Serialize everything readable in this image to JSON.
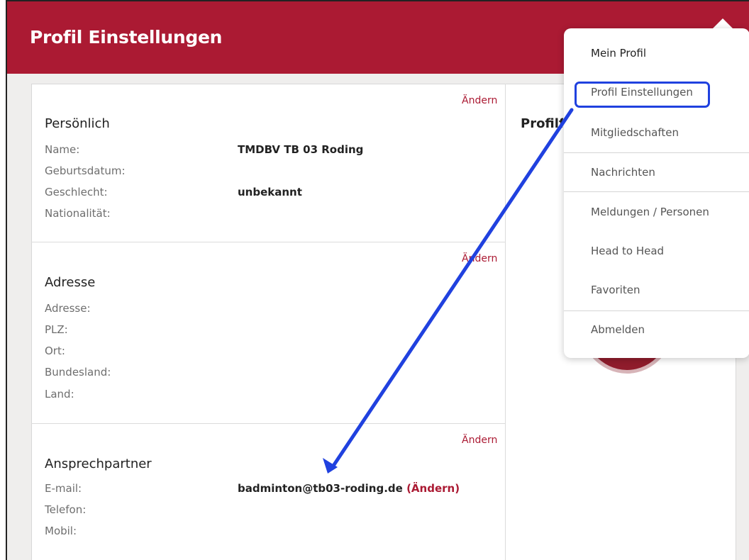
{
  "header": {
    "title": "Profil Einstellungen"
  },
  "sections": {
    "personal": {
      "title": "Persönlich",
      "change_label": "Ändern",
      "fields": [
        {
          "label": "Name:",
          "value": "TMDBV TB 03 Roding"
        },
        {
          "label": "Geburtsdatum:",
          "value": ""
        },
        {
          "label": "Geschlecht:",
          "value": "unbekannt"
        },
        {
          "label": "Nationalität:",
          "value": ""
        }
      ]
    },
    "address": {
      "title": "Adresse",
      "change_label": "Ändern",
      "fields": [
        {
          "label": "Adresse:",
          "value": ""
        },
        {
          "label": "PLZ:",
          "value": ""
        },
        {
          "label": "Ort:",
          "value": ""
        },
        {
          "label": "Bundesland:",
          "value": ""
        },
        {
          "label": "Land:",
          "value": ""
        }
      ]
    },
    "contact": {
      "title": "Ansprechpartner",
      "change_label": "Ändern",
      "fields": [
        {
          "label": "E-mail:",
          "value": "badminton@tb03-roding.de",
          "inline_change": "(Ändern)"
        },
        {
          "label": "Telefon:",
          "value": ""
        },
        {
          "label": "Mobil:",
          "value": ""
        }
      ]
    }
  },
  "right_panel": {
    "title_partial": "Profilfoto"
  },
  "menu": {
    "items": [
      {
        "label": "Mein Profil"
      },
      {
        "label": "Profil Einstellungen"
      },
      {
        "label": "Mitgliedschaften"
      },
      {
        "label": "Nachrichten"
      },
      {
        "label": "Meldungen / Personen"
      },
      {
        "label": "Head to Head"
      },
      {
        "label": "Favoriten"
      },
      {
        "label": "Abmelden"
      }
    ]
  },
  "colors": {
    "brand": "#ab1a33",
    "annotation_blue": "#2041df"
  }
}
